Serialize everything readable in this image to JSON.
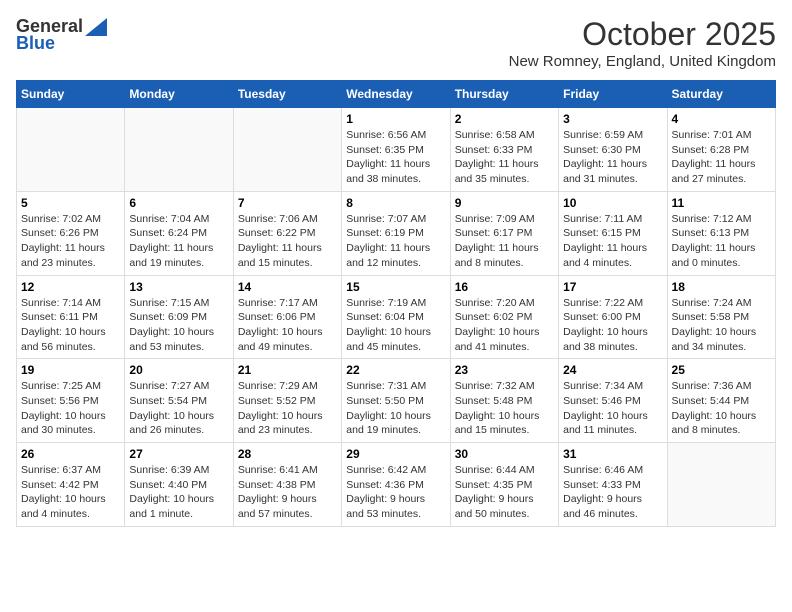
{
  "header": {
    "logo_general": "General",
    "logo_blue": "Blue",
    "month": "October 2025",
    "location": "New Romney, England, United Kingdom"
  },
  "weekdays": [
    "Sunday",
    "Monday",
    "Tuesday",
    "Wednesday",
    "Thursday",
    "Friday",
    "Saturday"
  ],
  "weeks": [
    [
      {
        "day": "",
        "info": ""
      },
      {
        "day": "",
        "info": ""
      },
      {
        "day": "",
        "info": ""
      },
      {
        "day": "1",
        "info": "Sunrise: 6:56 AM\nSunset: 6:35 PM\nDaylight: 11 hours\nand 38 minutes."
      },
      {
        "day": "2",
        "info": "Sunrise: 6:58 AM\nSunset: 6:33 PM\nDaylight: 11 hours\nand 35 minutes."
      },
      {
        "day": "3",
        "info": "Sunrise: 6:59 AM\nSunset: 6:30 PM\nDaylight: 11 hours\nand 31 minutes."
      },
      {
        "day": "4",
        "info": "Sunrise: 7:01 AM\nSunset: 6:28 PM\nDaylight: 11 hours\nand 27 minutes."
      }
    ],
    [
      {
        "day": "5",
        "info": "Sunrise: 7:02 AM\nSunset: 6:26 PM\nDaylight: 11 hours\nand 23 minutes."
      },
      {
        "day": "6",
        "info": "Sunrise: 7:04 AM\nSunset: 6:24 PM\nDaylight: 11 hours\nand 19 minutes."
      },
      {
        "day": "7",
        "info": "Sunrise: 7:06 AM\nSunset: 6:22 PM\nDaylight: 11 hours\nand 15 minutes."
      },
      {
        "day": "8",
        "info": "Sunrise: 7:07 AM\nSunset: 6:19 PM\nDaylight: 11 hours\nand 12 minutes."
      },
      {
        "day": "9",
        "info": "Sunrise: 7:09 AM\nSunset: 6:17 PM\nDaylight: 11 hours\nand 8 minutes."
      },
      {
        "day": "10",
        "info": "Sunrise: 7:11 AM\nSunset: 6:15 PM\nDaylight: 11 hours\nand 4 minutes."
      },
      {
        "day": "11",
        "info": "Sunrise: 7:12 AM\nSunset: 6:13 PM\nDaylight: 11 hours\nand 0 minutes."
      }
    ],
    [
      {
        "day": "12",
        "info": "Sunrise: 7:14 AM\nSunset: 6:11 PM\nDaylight: 10 hours\nand 56 minutes."
      },
      {
        "day": "13",
        "info": "Sunrise: 7:15 AM\nSunset: 6:09 PM\nDaylight: 10 hours\nand 53 minutes."
      },
      {
        "day": "14",
        "info": "Sunrise: 7:17 AM\nSunset: 6:06 PM\nDaylight: 10 hours\nand 49 minutes."
      },
      {
        "day": "15",
        "info": "Sunrise: 7:19 AM\nSunset: 6:04 PM\nDaylight: 10 hours\nand 45 minutes."
      },
      {
        "day": "16",
        "info": "Sunrise: 7:20 AM\nSunset: 6:02 PM\nDaylight: 10 hours\nand 41 minutes."
      },
      {
        "day": "17",
        "info": "Sunrise: 7:22 AM\nSunset: 6:00 PM\nDaylight: 10 hours\nand 38 minutes."
      },
      {
        "day": "18",
        "info": "Sunrise: 7:24 AM\nSunset: 5:58 PM\nDaylight: 10 hours\nand 34 minutes."
      }
    ],
    [
      {
        "day": "19",
        "info": "Sunrise: 7:25 AM\nSunset: 5:56 PM\nDaylight: 10 hours\nand 30 minutes."
      },
      {
        "day": "20",
        "info": "Sunrise: 7:27 AM\nSunset: 5:54 PM\nDaylight: 10 hours\nand 26 minutes."
      },
      {
        "day": "21",
        "info": "Sunrise: 7:29 AM\nSunset: 5:52 PM\nDaylight: 10 hours\nand 23 minutes."
      },
      {
        "day": "22",
        "info": "Sunrise: 7:31 AM\nSunset: 5:50 PM\nDaylight: 10 hours\nand 19 minutes."
      },
      {
        "day": "23",
        "info": "Sunrise: 7:32 AM\nSunset: 5:48 PM\nDaylight: 10 hours\nand 15 minutes."
      },
      {
        "day": "24",
        "info": "Sunrise: 7:34 AM\nSunset: 5:46 PM\nDaylight: 10 hours\nand 11 minutes."
      },
      {
        "day": "25",
        "info": "Sunrise: 7:36 AM\nSunset: 5:44 PM\nDaylight: 10 hours\nand 8 minutes."
      }
    ],
    [
      {
        "day": "26",
        "info": "Sunrise: 6:37 AM\nSunset: 4:42 PM\nDaylight: 10 hours\nand 4 minutes."
      },
      {
        "day": "27",
        "info": "Sunrise: 6:39 AM\nSunset: 4:40 PM\nDaylight: 10 hours\nand 1 minute."
      },
      {
        "day": "28",
        "info": "Sunrise: 6:41 AM\nSunset: 4:38 PM\nDaylight: 9 hours\nand 57 minutes."
      },
      {
        "day": "29",
        "info": "Sunrise: 6:42 AM\nSunset: 4:36 PM\nDaylight: 9 hours\nand 53 minutes."
      },
      {
        "day": "30",
        "info": "Sunrise: 6:44 AM\nSunset: 4:35 PM\nDaylight: 9 hours\nand 50 minutes."
      },
      {
        "day": "31",
        "info": "Sunrise: 6:46 AM\nSunset: 4:33 PM\nDaylight: 9 hours\nand 46 minutes."
      },
      {
        "day": "",
        "info": ""
      }
    ]
  ]
}
